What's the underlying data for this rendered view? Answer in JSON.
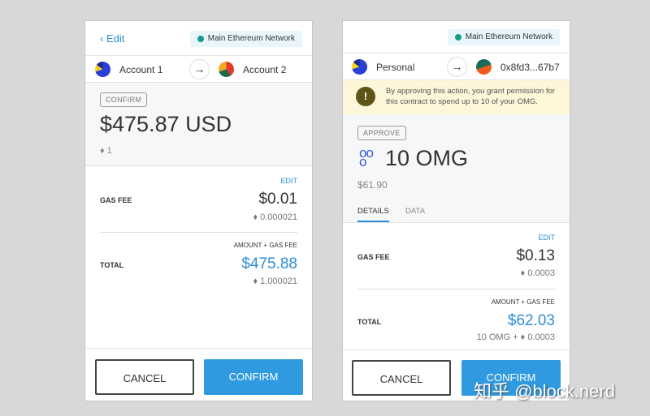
{
  "left": {
    "back": "Edit",
    "network": "Main Ethereum Network",
    "from": "Account 1",
    "to": "Account 2",
    "badge": "CONFIRM",
    "amount": "$475.87 USD",
    "eth": "♦ 1",
    "edit": "EDIT",
    "gas_label": "GAS FEE",
    "gas_usd": "$0.01",
    "gas_eth": "♦ 0.000021",
    "amount_gas": "AMOUNT + GAS FEE",
    "total_label": "TOTAL",
    "total_usd": "$475.88",
    "total_eth": "♦ 1.000021",
    "cancel": "CANCEL",
    "confirm": "CONFIRM"
  },
  "right": {
    "network": "Main Ethereum Network",
    "from": "Personal",
    "to": "0x8fd3...67b7",
    "warning": "By approving this action, you grant permission for this contract to spend up to 10 of your OMG.",
    "badge": "APPROVE",
    "amount": "10 OMG",
    "usd": "$61.90",
    "tabs": [
      "DETAILS",
      "DATA"
    ],
    "edit": "EDIT",
    "gas_label": "GAS FEE",
    "gas_usd": "$0.13",
    "gas_eth": "♦ 0.0003",
    "amount_gas": "AMOUNT + GAS FEE",
    "total_label": "TOTAL",
    "total_usd": "$62.03",
    "total_sub": "10 OMG + ♦ 0.0003",
    "cancel": "CANCEL",
    "confirm": "CONFIRM"
  },
  "watermark": "知乎 @block.nerd",
  "colors": {
    "accent": "#2f9ae0",
    "warning_bg": "#fdf6d8",
    "network_dot": "#1a9a8a"
  }
}
